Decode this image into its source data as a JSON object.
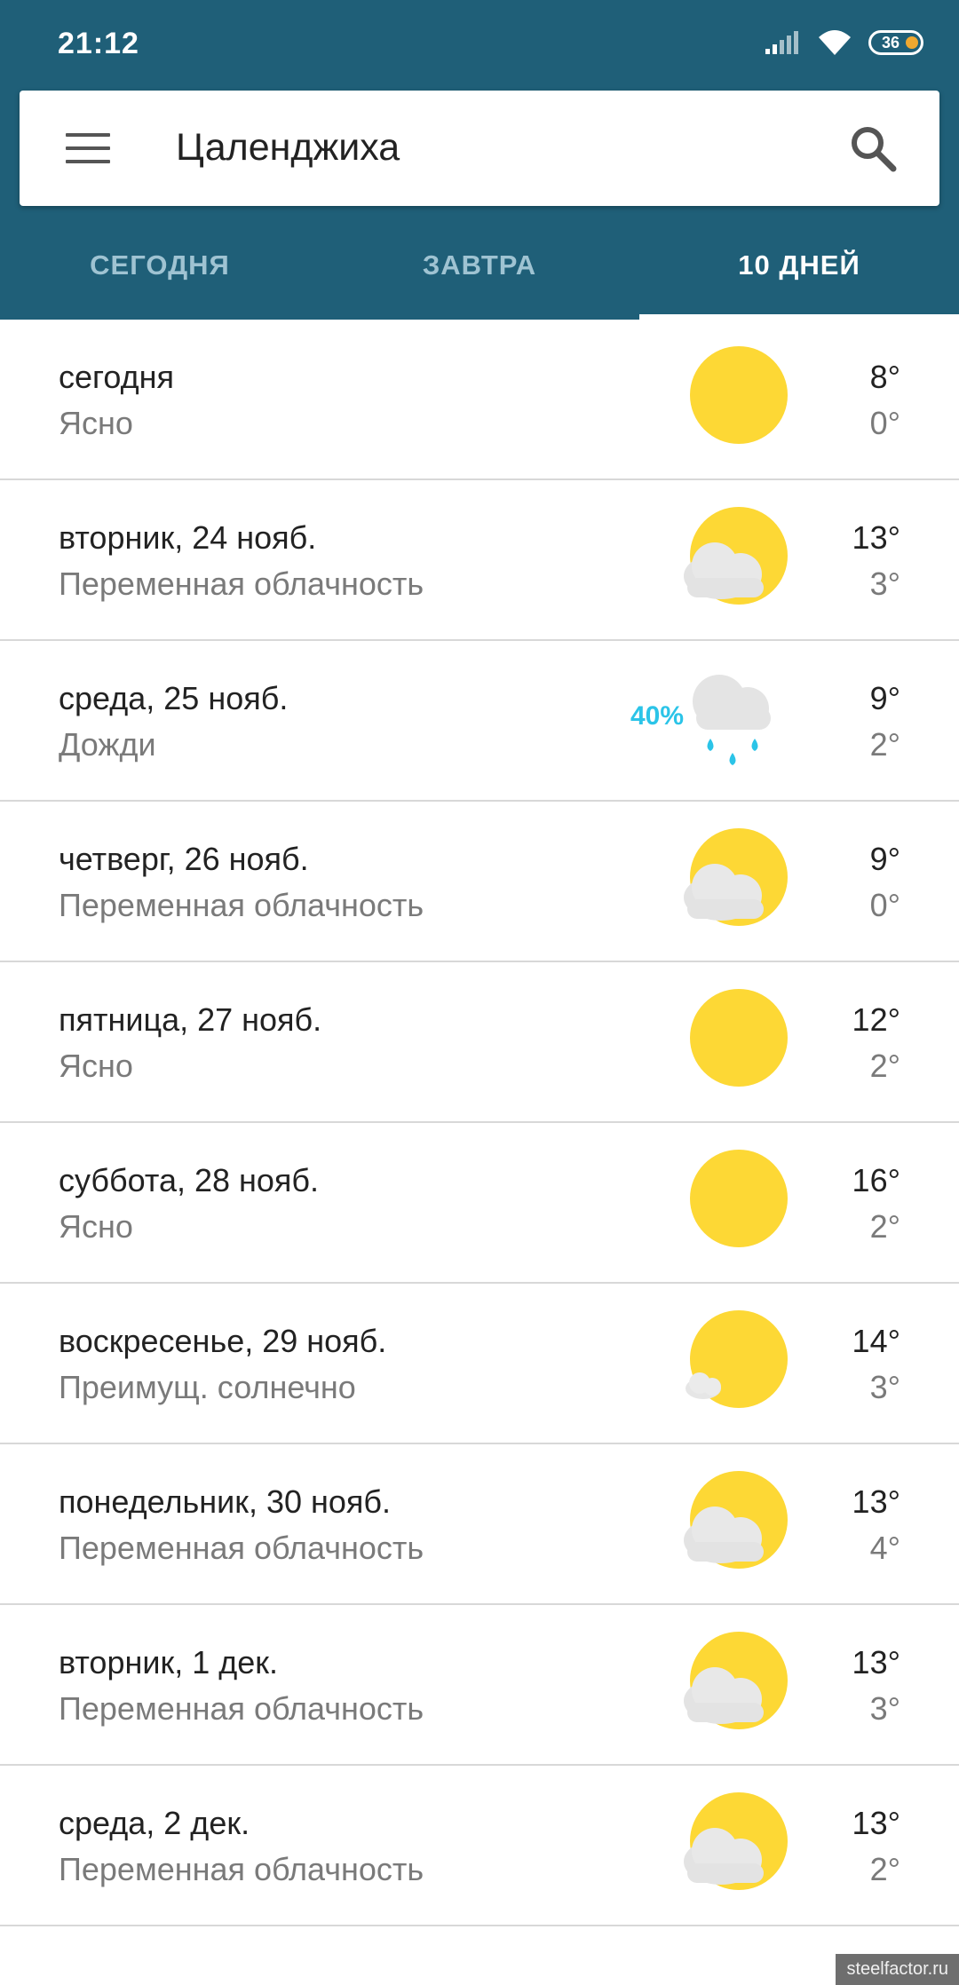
{
  "status_bar": {
    "time": "21:12",
    "battery": "36"
  },
  "search": {
    "city": "Цаленджиха"
  },
  "tabs": [
    {
      "label": "СЕГОДНЯ",
      "active": false
    },
    {
      "label": "ЗАВТРА",
      "active": false
    },
    {
      "label": "10 ДНЕЙ",
      "active": true
    }
  ],
  "forecast": [
    {
      "day": "сегодня",
      "condition": "Ясно",
      "high": "8°",
      "low": "0°",
      "icon": "sun-icon"
    },
    {
      "day": "вторник, 24 нояб.",
      "condition": "Переменная облачность",
      "high": "13°",
      "low": "3°",
      "icon": "partly-cloudy-icon"
    },
    {
      "day": "среда, 25 нояб.",
      "condition": "Дожди",
      "high": "9°",
      "low": "2°",
      "icon": "rain-icon",
      "precip": "40%"
    },
    {
      "day": "четверг, 26 нояб.",
      "condition": "Переменная облачность",
      "high": "9°",
      "low": "0°",
      "icon": "partly-cloudy-icon"
    },
    {
      "day": "пятница, 27 нояб.",
      "condition": "Ясно",
      "high": "12°",
      "low": "2°",
      "icon": "sun-icon"
    },
    {
      "day": "суббота, 28 нояб.",
      "condition": "Ясно",
      "high": "16°",
      "low": "2°",
      "icon": "sun-icon"
    },
    {
      "day": "воскресенье, 29 нояб.",
      "condition": "Преимущ. солнечно",
      "high": "14°",
      "low": "3°",
      "icon": "mostly-sunny-icon"
    },
    {
      "day": "понедельник, 30 нояб.",
      "condition": "Переменная облачность",
      "high": "13°",
      "low": "4°",
      "icon": "partly-cloudy-icon"
    },
    {
      "day": "вторник, 1 дек.",
      "condition": "Переменная облачность",
      "high": "13°",
      "low": "3°",
      "icon": "partly-cloudy-icon"
    },
    {
      "day": "среда, 2 дек.",
      "condition": "Переменная облачность",
      "high": "13°",
      "low": "2°",
      "icon": "partly-cloudy-icon"
    }
  ],
  "watermark": "steelfactor.ru",
  "colors": {
    "header": "#1f5f78",
    "tab_inactive": "#9fc3d2",
    "sun": "#fdd835",
    "cloud": "#e6e6e6",
    "rain": "#2bc4e8"
  }
}
